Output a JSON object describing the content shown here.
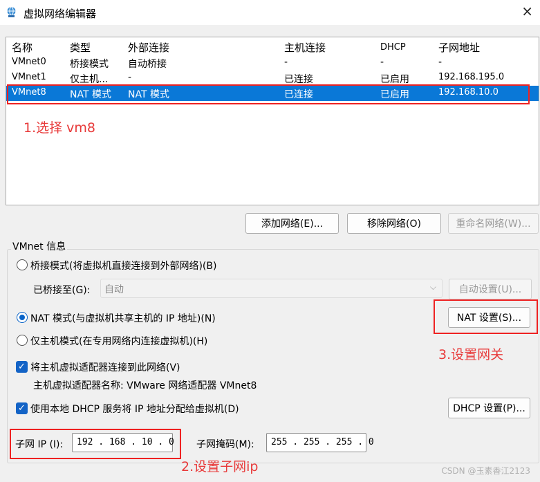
{
  "window": {
    "title": "虚拟网络编辑器",
    "close": "×"
  },
  "columns": [
    "名称",
    "类型",
    "外部连接",
    "主机连接",
    "DHCP",
    "子网地址"
  ],
  "rows": [
    {
      "name": "VMnet0",
      "type": "桥接模式",
      "external": "自动桥接",
      "host": "-",
      "dhcp": "-",
      "subnet": "-"
    },
    {
      "name": "VMnet1",
      "type": "仅主机...",
      "external": "-",
      "host": "已连接",
      "dhcp": "已启用",
      "subnet": "192.168.195.0"
    },
    {
      "name": "VMnet8",
      "type": "NAT 模式",
      "external": "NAT 模式",
      "host": "已连接",
      "dhcp": "已启用",
      "subnet": "192.168.10.0"
    }
  ],
  "annotations": {
    "step1": "1.选择 vm8",
    "step2": "2.设置子网ip",
    "step3": "3.设置网关"
  },
  "buttons": {
    "add_network": "添加网络(E)...",
    "remove_network": "移除网络(O)",
    "rename_network": "重命名网络(W)...",
    "auto_settings": "自动设置(U)...",
    "nat_settings": "NAT 设置(S)...",
    "dhcp_settings": "DHCP 设置(P)..."
  },
  "vmnet_info": {
    "label": "VMnet 信息",
    "bridged": "桥接模式(将虚拟机直接连接到外部网络)(B)",
    "bridged_to_label": "已桥接至(G):",
    "bridged_to_value": "自动",
    "nat": "NAT 模式(与虚拟机共享主机的 IP 地址)(N)",
    "host_only": "仅主机模式(在专用网络内连接虚拟机)(H)",
    "connect_adapter": "将主机虚拟适配器连接到此网络(V)",
    "adapter_name": "主机虚拟适配器名称: VMware 网络适配器 VMnet8",
    "use_dhcp": "使用本地 DHCP 服务将 IP 地址分配给虚拟机(D)",
    "subnet_ip_label": "子网 IP (I):",
    "subnet_ip_value": "192 . 168 . 10  .  0",
    "subnet_mask_label": "子网掩码(M):",
    "subnet_mask_value": "255 . 255 . 255 .  0"
  },
  "watermark": "CSDN @玉素香江2123",
  "colors": {
    "selection": "#0a78d7",
    "annotation": "#e83a3a",
    "checkbox": "#1363c6"
  }
}
